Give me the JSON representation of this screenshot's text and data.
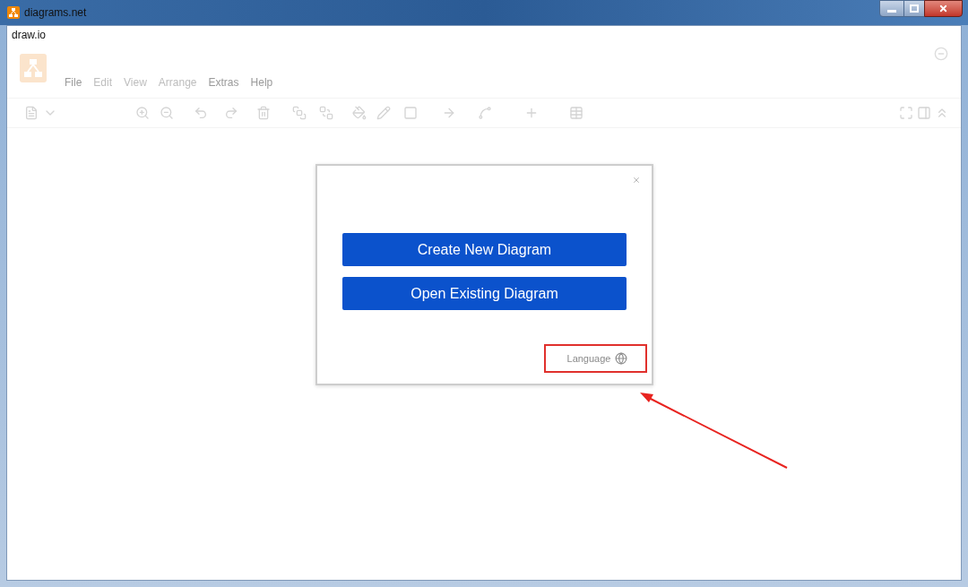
{
  "window": {
    "title": "diagrams.net"
  },
  "page_title": "draw.io",
  "menu": [
    {
      "label": "File",
      "disabled": false
    },
    {
      "label": "Edit",
      "disabled": true
    },
    {
      "label": "View",
      "disabled": true
    },
    {
      "label": "Arrange",
      "disabled": true
    },
    {
      "label": "Extras",
      "disabled": false
    },
    {
      "label": "Help",
      "disabled": false
    }
  ],
  "dialog": {
    "buttons": [
      "Create New Diagram",
      "Open Existing Diagram"
    ],
    "language": {
      "label": "Language",
      "highlighted": true
    }
  }
}
